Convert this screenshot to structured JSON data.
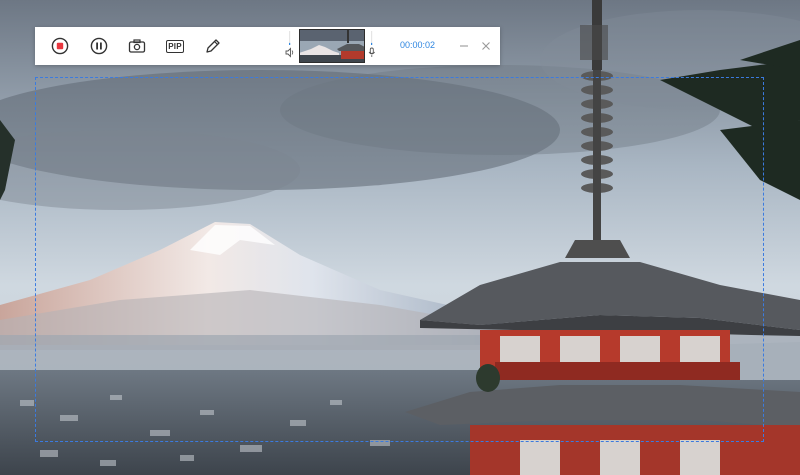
{
  "toolbar": {
    "buttons": [
      {
        "name": "stop-record-icon"
      },
      {
        "name": "pause-icon"
      },
      {
        "name": "screenshot-camera-icon"
      },
      {
        "name": "picture-in-picture-icon",
        "label": "PIP"
      },
      {
        "name": "edit-pen-icon"
      }
    ],
    "pip_label": "PIP",
    "timer": "00:00:02",
    "speaker_level": 0.15,
    "mic_level": 0.15
  },
  "colors": {
    "stop_red": "#e8373f",
    "accent_blue": "#2f86e0",
    "region_border": "#3b7be0"
  }
}
